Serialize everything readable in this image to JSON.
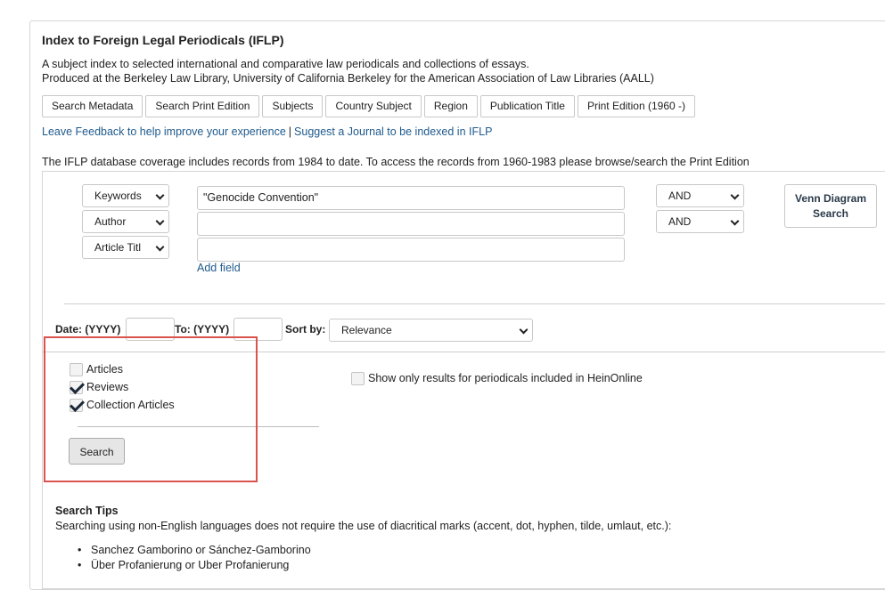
{
  "header": {
    "title": "Index to Foreign Legal Periodicals (IFLP)",
    "description_line1": "A subject index to selected international and comparative law periodicals and collections of essays.",
    "description_line2": "Produced at the Berkeley Law Library, University of California Berkeley for the American Association of Law Libraries (AALL)"
  },
  "tabs": [
    {
      "label": "Search Metadata"
    },
    {
      "label": "Search Print Edition"
    },
    {
      "label": "Subjects"
    },
    {
      "label": "Country Subject"
    },
    {
      "label": "Region"
    },
    {
      "label": "Publication Title"
    },
    {
      "label": "Print Edition (1960 -)"
    }
  ],
  "links": {
    "feedback": "Leave Feedback to help improve your experience",
    "separator": "|",
    "suggest": "Suggest a Journal to be indexed in IFLP"
  },
  "coverage_note": "The IFLP database coverage includes records from 1984 to date. To access the records from 1960-1983 please browse/search the Print Edition",
  "search_rows": [
    {
      "field": "Keywords",
      "value": "\"Genocide Convention\"",
      "operator": "AND"
    },
    {
      "field": "Author",
      "value": "",
      "operator": "AND"
    },
    {
      "field": "Article Titl",
      "value": ""
    }
  ],
  "add_field": "Add field",
  "venn_button": {
    "line1": "Venn Diagram",
    "line2": "Search"
  },
  "date": {
    "from_label": "Date: (YYYY)",
    "to_label": "To: (YYYY)",
    "from_value": "",
    "to_value": ""
  },
  "sort": {
    "label": "Sort by:",
    "value": "Relevance"
  },
  "types": [
    {
      "label": "Articles",
      "checked": false
    },
    {
      "label": "Reviews",
      "checked": true
    },
    {
      "label": "Collection Articles",
      "checked": true
    }
  ],
  "heinonline_option": {
    "label": "Show only results for periodicals included in HeinOnline",
    "checked": false
  },
  "search_button": "Search",
  "tips": {
    "title": "Search Tips",
    "text": "Searching using non-English languages does not require the use of diacritical marks (accent, dot, hyphen, tilde, umlaut, etc.):",
    "examples": [
      "Sanchez Gamborino or Sánchez-Gamborino",
      "Über Profanierung or Uber Profanierung"
    ]
  },
  "colors": {
    "link": "#1f5a8c",
    "highlight": "#d9534f"
  }
}
